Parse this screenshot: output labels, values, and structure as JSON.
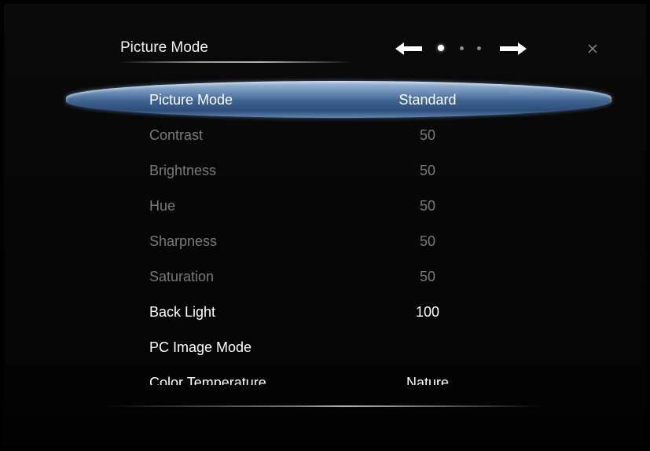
{
  "header": {
    "title": "Picture Mode",
    "page_indicator": {
      "total": 3,
      "current": 1
    }
  },
  "menu": {
    "selected_index": 0,
    "items": [
      {
        "label": "Picture Mode",
        "value": "Standard",
        "enabled": true
      },
      {
        "label": "Contrast",
        "value": "50",
        "enabled": false
      },
      {
        "label": "Brightness",
        "value": "50",
        "enabled": false
      },
      {
        "label": "Hue",
        "value": "50",
        "enabled": false
      },
      {
        "label": "Sharpness",
        "value": "50",
        "enabled": false
      },
      {
        "label": "Saturation",
        "value": "50",
        "enabled": false
      },
      {
        "label": "Back Light",
        "value": "100",
        "enabled": true
      },
      {
        "label": "PC Image Mode",
        "value": "",
        "enabled": true
      },
      {
        "label": "Color Temperature",
        "value": "Nature",
        "enabled": true
      }
    ]
  },
  "icons": {
    "prev": "left-arrow-icon",
    "next": "right-arrow-icon",
    "close": "close-icon"
  },
  "colors": {
    "highlight": "#4a6c98",
    "text_enabled": "#ffffff",
    "text_disabled": "#7a7a7a"
  }
}
